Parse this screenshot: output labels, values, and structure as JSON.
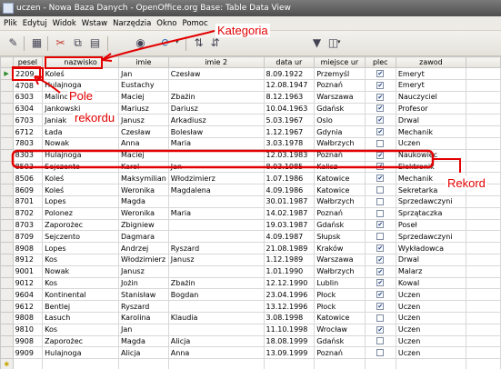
{
  "window": {
    "title": "uczen - Nowa Baza Danych - OpenOffice.org Base: Table Data View"
  },
  "menu": [
    "Plik",
    "Edytuj",
    "Widok",
    "Wstaw",
    "Narzędzia",
    "Okno",
    "Pomoc"
  ],
  "toolbar": {
    "icons": [
      "edit-data-icon",
      "save-icon",
      "cut-icon",
      "copy-icon",
      "paste-icon",
      "find-icon",
      "refresh-icon",
      "sort-ascending-icon",
      "sort-descending-icon",
      "autofilter-icon",
      "standard-filter-icon"
    ]
  },
  "columns": [
    "pesel",
    "nazwisko",
    "imie",
    "imie 2",
    "data ur",
    "miejsce ur",
    "plec",
    "zawod"
  ],
  "rows": [
    {
      "id": "2209",
      "nazwisko": "Koleś",
      "imie": "Jan",
      "imie2": "Czesław",
      "data_ur": "8.09.1922",
      "miejsce_ur": "Przemyśl",
      "plec": true,
      "zawod": "Emeryt"
    },
    {
      "id": "4708",
      "nazwisko": "Hulajnoga",
      "imie": "Eustachy",
      "imie2": "",
      "data_ur": "12.08.1947",
      "miejsce_ur": "Poznań",
      "plec": true,
      "zawod": "Emeryt"
    },
    {
      "id": "6303",
      "nazwisko": "Malinowski",
      "imie": "Maciej",
      "imie2": "Zbażin",
      "data_ur": "8.12.1963",
      "miejsce_ur": "Warszawa",
      "plec": true,
      "zawod": "Nauczyciel"
    },
    {
      "id": "6304",
      "nazwisko": "Jankowski",
      "imie": "Mariusz",
      "imie2": "Dariusz",
      "data_ur": "10.04.1963",
      "miejsce_ur": "Gdańsk",
      "plec": true,
      "zawod": "Profesor"
    },
    {
      "id": "6703",
      "nazwisko": "Janiak",
      "imie": "Janusz",
      "imie2": "Arkadiusz",
      "data_ur": "5.03.1967",
      "miejsce_ur": "Oslo",
      "plec": true,
      "zawod": "Drwal"
    },
    {
      "id": "6712",
      "nazwisko": "Łada",
      "imie": "Czesław",
      "imie2": "Bolesław",
      "data_ur": "1.12.1967",
      "miejsce_ur": "Gdynia",
      "plec": true,
      "zawod": "Mechanik"
    },
    {
      "id": "7803",
      "nazwisko": "Nowak",
      "imie": "Anna",
      "imie2": "Maria",
      "data_ur": "3.03.1978",
      "miejsce_ur": "Wałbrzych",
      "plec": false,
      "zawod": "Uczen"
    },
    {
      "id": "8303",
      "nazwisko": "Hulajnoga",
      "imie": "Maciej",
      "imie2": "",
      "data_ur": "12.03.1983",
      "miejsce_ur": "Poznań",
      "plec": true,
      "zawod": "Naukowiec"
    },
    {
      "id": "8503",
      "nazwisko": "Sejczento",
      "imie": "Karol",
      "imie2": "Jan",
      "data_ur": "8.03.1985",
      "miejsce_ur": "Kalisz",
      "plec": true,
      "zawod": "Elektronik"
    },
    {
      "id": "8506",
      "nazwisko": "Koleś",
      "imie": "Maksymilian",
      "imie2": "Włodzimierz",
      "data_ur": "1.07.1986",
      "miejsce_ur": "Katowice",
      "plec": true,
      "zawod": "Mechanik"
    },
    {
      "id": "8609",
      "nazwisko": "Koleś",
      "imie": "Weronika",
      "imie2": "Magdalena",
      "data_ur": "4.09.1986",
      "miejsce_ur": "Katowice",
      "plec": false,
      "zawod": "Sekretarka"
    },
    {
      "id": "8701",
      "nazwisko": "Lopes",
      "imie": "Magda",
      "imie2": "",
      "data_ur": "30.01.1987",
      "miejsce_ur": "Wałbrzych",
      "plec": false,
      "zawod": "Sprzedawczyni"
    },
    {
      "id": "8702",
      "nazwisko": "Polonez",
      "imie": "Weronika",
      "imie2": "Maria",
      "data_ur": "14.02.1987",
      "miejsce_ur": "Poznań",
      "plec": false,
      "zawod": "Sprzątaczka"
    },
    {
      "id": "8703",
      "nazwisko": "Zaporożec",
      "imie": "Zbigniew",
      "imie2": "",
      "data_ur": "19.03.1987",
      "miejsce_ur": "Gdańsk",
      "plec": true,
      "zawod": "Poseł"
    },
    {
      "id": "8709",
      "nazwisko": "Sejczento",
      "imie": "Dagmara",
      "imie2": "",
      "data_ur": "4.09.1987",
      "miejsce_ur": "Słupsk",
      "plec": false,
      "zawod": "Sprzedawczyni"
    },
    {
      "id": "8908",
      "nazwisko": "Lopes",
      "imie": "Andrzej",
      "imie2": "Ryszard",
      "data_ur": "21.08.1989",
      "miejsce_ur": "Kraków",
      "plec": true,
      "zawod": "Wykładowca"
    },
    {
      "id": "8912",
      "nazwisko": "Kos",
      "imie": "Włodzimierz",
      "imie2": "Janusz",
      "data_ur": "1.12.1989",
      "miejsce_ur": "Warszawa",
      "plec": true,
      "zawod": "Drwal"
    },
    {
      "id": "9001",
      "nazwisko": "Nowak",
      "imie": "Janusz",
      "imie2": "",
      "data_ur": "1.01.1990",
      "miejsce_ur": "Wałbrzych",
      "plec": true,
      "zawod": "Malarz"
    },
    {
      "id": "9012",
      "nazwisko": "Kos",
      "imie": "Jożin",
      "imie2": "Zbażin",
      "data_ur": "12.12.1990",
      "miejsce_ur": "Lublin",
      "plec": true,
      "zawod": "Kowal"
    },
    {
      "id": "9604",
      "nazwisko": "Kontinental",
      "imie": "Stanisław",
      "imie2": "Bogdan",
      "data_ur": "23.04.1996",
      "miejsce_ur": "Płock",
      "plec": true,
      "zawod": "Uczen"
    },
    {
      "id": "9612",
      "nazwisko": "Bentlej",
      "imie": "Ryszard",
      "imie2": "",
      "data_ur": "13.12.1996",
      "miejsce_ur": "Płock",
      "plec": true,
      "zawod": "Uczen"
    },
    {
      "id": "9808",
      "nazwisko": "Łasuch",
      "imie": "Karolina",
      "imie2": "Klaudia",
      "data_ur": "3.08.1998",
      "miejsce_ur": "Katowice",
      "plec": false,
      "zawod": "Uczen"
    },
    {
      "id": "9810",
      "nazwisko": "Kos",
      "imie": "Jan",
      "imie2": "",
      "data_ur": "11.10.1998",
      "miejsce_ur": "Wrocław",
      "plec": true,
      "zawod": "Uczen"
    },
    {
      "id": "9908",
      "nazwisko": "Zaporożec",
      "imie": "Magda",
      "imie2": "Alicja",
      "data_ur": "18.08.1999",
      "miejsce_ur": "Gdańsk",
      "plec": false,
      "zawod": "Uczen"
    },
    {
      "id": "9909",
      "nazwisko": "Hulajnoga",
      "imie": "Alicja",
      "imie2": "Anna",
      "data_ur": "13.09.1999",
      "miejsce_ur": "Poznań",
      "plec": false,
      "zawod": "Uczen"
    }
  ],
  "annotations": {
    "kategoria": "Kategoria",
    "pole": "Pole",
    "rekordu": "rekordu",
    "rekord": "Rekord",
    "color": "#e20000"
  }
}
